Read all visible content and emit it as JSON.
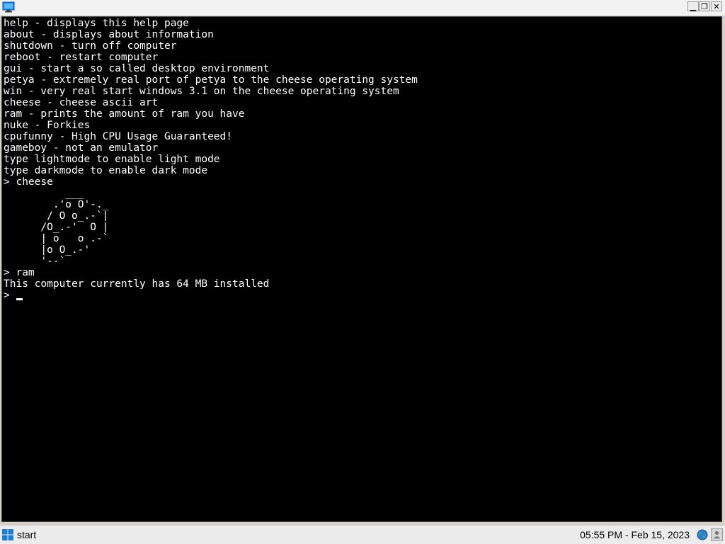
{
  "titlebar": {
    "app_icon": "monitor-icon",
    "minimize_glyph": "▁",
    "maximize_glyph": "❐",
    "close_glyph": "✕"
  },
  "terminal": {
    "lines": [
      "help - displays this help page",
      "about - displays about information",
      "shutdown - turn off computer",
      "reboot - restart computer",
      "gui - start a so called desktop environment",
      "petya - extremely real port of petya to the cheese operating system",
      "win - very real start windows 3.1 on the cheese operating system",
      "cheese - cheese ascii art",
      "ram - prints the amount of ram you have",
      "nuke - Forkies",
      "cpufunny - High CPU Usage Guaranteed!",
      "gameboy - not an emulator",
      "type lightmode to enable light mode",
      "type darkmode to enable dark mode",
      "> cheese",
      "          ___",
      "        .'o O'-._",
      "       / O o_.-`|",
      "      /O_.-'  O |",
      "      | o   o .-`",
      "      |o O_.-'",
      "      '--`",
      "> ram",
      "This computer currently has 64 MB installed"
    ],
    "prompt": ">",
    "background": "#000000",
    "foreground": "#ffffff"
  },
  "taskbar": {
    "start_label": "start",
    "start_icon": "windows-logo-icon",
    "clock": "05:55 PM - Feb 15, 2023",
    "tray_icons": [
      "globe-icon",
      "user-icon"
    ]
  }
}
